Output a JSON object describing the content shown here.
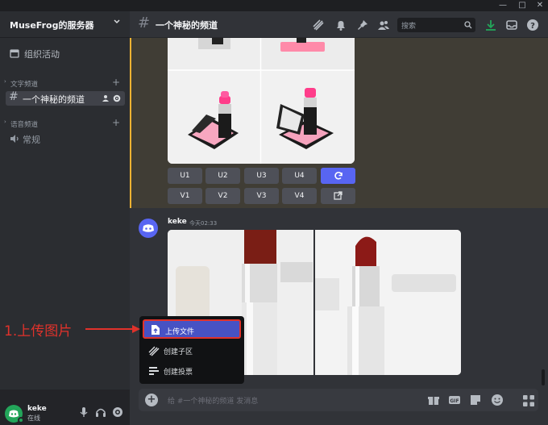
{
  "window": {
    "minimize_icon": "minimize",
    "maximize_icon": "maximize",
    "close_icon": "close"
  },
  "sidebar": {
    "server_name": "MuseFrog的服务器",
    "event_label": "组织活动",
    "text_category": "文字频道",
    "selected_channel": "一个神秘的频道",
    "voice_category": "语音频道",
    "voice_channel": "常规"
  },
  "header": {
    "hash": "#",
    "channel_title": "一个神秘的频道",
    "search_placeholder": "搜索"
  },
  "message1": {
    "buttons_row1": [
      "U1",
      "U2",
      "U3",
      "U4"
    ],
    "buttons_row2": [
      "V1",
      "V2",
      "V3",
      "V4"
    ],
    "accent_color": "#f0b232"
  },
  "message2": {
    "author": "keke",
    "timestamp": "今天02:33"
  },
  "composer": {
    "placeholder": "给 #一个神秘的频道 发消息"
  },
  "popup_menu": {
    "items": [
      "上传文件",
      "创建子区",
      "创建投票"
    ],
    "selected_index": 0
  },
  "annotation": {
    "text": "1.上传图片"
  },
  "user": {
    "name": "keke",
    "status": "在线"
  },
  "colors": {
    "accent_blue": "#5865f2",
    "highlight_red": "#e0322b",
    "online_green": "#23a55a"
  }
}
